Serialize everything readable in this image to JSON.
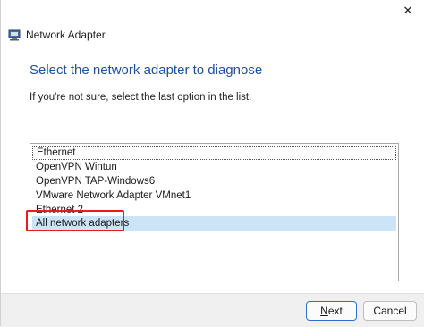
{
  "window": {
    "title": "Network Adapter",
    "close_label": "✕"
  },
  "page": {
    "heading": "Select the network adapter to diagnose",
    "hint": "If you're not sure, select the last option in the list."
  },
  "adapters": [
    {
      "label": "Ethernet"
    },
    {
      "label": "OpenVPN Wintun"
    },
    {
      "label": "OpenVPN TAP-Windows6"
    },
    {
      "label": "VMware Network Adapter VMnet1"
    },
    {
      "label": "Ethernet 2"
    },
    {
      "label": "All network adapters"
    }
  ],
  "buttons": {
    "next_first": "N",
    "next_rest": "ext",
    "cancel": "Cancel"
  },
  "colors": {
    "heading": "#1f4e9b",
    "selection": "#cce4f7",
    "highlight": "#e02020"
  }
}
